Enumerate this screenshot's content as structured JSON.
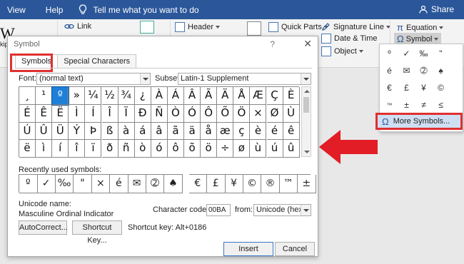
{
  "topbar": {
    "tabs": [
      "View",
      "Help"
    ],
    "tell_me": "Tell me what you want to do",
    "share": "Share"
  },
  "ribbon": {
    "link": "Link",
    "header": "Header",
    "quick_parts": "Quick Parts",
    "signature_line": "Signature Line",
    "date_time": "Date & Time",
    "object": "Object",
    "equation": "Equation",
    "symbol": "Symbol",
    "doc_fragment_1": "W",
    "doc_fragment_2": "kipe"
  },
  "gallery": {
    "symbols": [
      "º",
      "✓",
      "‰",
      "\"",
      "é",
      "✉",
      "➁",
      "♠",
      "€",
      "£",
      "¥",
      "©",
      "™",
      "±",
      "≠",
      "≤"
    ],
    "more_symbols": "More Symbols..."
  },
  "dialog": {
    "title": "Symbol",
    "help": "?",
    "close": "✕",
    "tabs": [
      "Symbols",
      "Special Characters"
    ],
    "font_label": "Font:",
    "font_value": "(normal text)",
    "subset_label": "Subset:",
    "subset_value": "Latin-1 Supplement",
    "symbols": [
      "¸",
      "¹",
      "º",
      "»",
      "¼",
      "½",
      "¾",
      "¿",
      "À",
      "Á",
      "Â",
      "Ã",
      "Ä",
      "Å",
      "Æ",
      "Ç",
      "È",
      "É",
      "Ê",
      "Ë",
      "Ì",
      "Í",
      "Î",
      "Ï",
      "Ð",
      "Ñ",
      "Ò",
      "Ó",
      "Ô",
      "Õ",
      "Ö",
      "×",
      "Ø",
      "Ù",
      "Ú",
      "Û",
      "Ü",
      "Ý",
      "Þ",
      "ß",
      "à",
      "á",
      "â",
      "ã",
      "ä",
      "å",
      "æ",
      "ç",
      "è",
      "é",
      "ê",
      "ë",
      "ì",
      "í",
      "î",
      "ï",
      "ð",
      "ñ",
      "ò",
      "ó",
      "ô",
      "õ",
      "ö",
      "÷",
      "ø",
      "ù",
      "ú",
      "û"
    ],
    "selected_index": 2,
    "recent_label": "Recently used symbols:",
    "recent_symbols": [
      "º",
      "✓",
      "‰",
      "\"",
      "×",
      "é",
      "✉",
      "➁",
      "♠",
      "",
      "€",
      "£",
      "¥",
      "©",
      "®",
      "™",
      "±"
    ],
    "unicode_name_label": "Unicode name:",
    "unicode_name": "Masculine Ordinal Indicator",
    "char_code_label": "Character code:",
    "char_code": "00BA",
    "from_label": "from:",
    "from_value": "Unicode (hex)",
    "autocorrect": "AutoCorrect...",
    "shortcut_key_btn": "Shortcut Key...",
    "shortcut_key_text": "Shortcut key: Alt+0186",
    "insert": "Insert",
    "cancel": "Cancel"
  },
  "colors": {
    "titlebar": "#2b579a",
    "selection": "#1e7fd8",
    "highlight": "#e03030"
  }
}
